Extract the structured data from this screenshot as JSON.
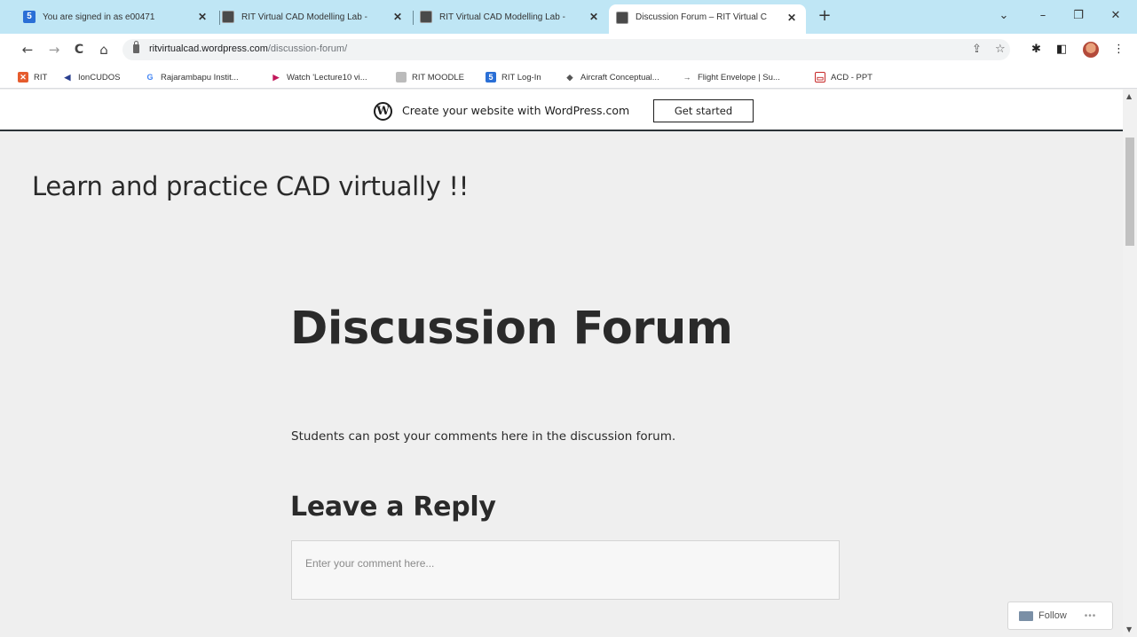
{
  "browser": {
    "tabs": [
      {
        "title": "You are signed in as e00471",
        "favicon": "s-icon"
      },
      {
        "title": "RIT Virtual CAD Modelling Lab -",
        "favicon": "site-icon"
      },
      {
        "title": "RIT Virtual CAD Modelling Lab -",
        "favicon": "site-icon"
      },
      {
        "title": "Discussion Forum – RIT Virtual C",
        "favicon": "site-icon",
        "active": true
      }
    ],
    "new_tab": "+",
    "window_controls": {
      "dropdown": "⌄",
      "minimize": "–",
      "restore": "❐",
      "close": "✕"
    },
    "nav": {
      "back": "←",
      "forward": "→",
      "reload": "C",
      "home": "⌂"
    },
    "url_domain": "ritvirtualcad.wordpress.com",
    "url_path": "/discussion-forum/",
    "toolbar_icons": {
      "share": "⇪",
      "star": "☆",
      "extensions": "✱",
      "sidepanel": "◧",
      "menu": "⋮"
    },
    "bookmarks": [
      {
        "label": "RIT",
        "color": "#e65c2e"
      },
      {
        "label": "IonCUDOS",
        "color": "#2a3f8f"
      },
      {
        "label": "Rajarambapu Instit...",
        "color": "#4285f4"
      },
      {
        "label": "Watch 'Lecture10 vi...",
        "color": "#c2185b"
      },
      {
        "label": "RIT MOODLE",
        "color": "#888888"
      },
      {
        "label": "RIT Log-In",
        "color": "#2a6fd6"
      },
      {
        "label": "Aircraft Conceptual...",
        "color": "#555555"
      },
      {
        "label": "Flight Envelope | Su...",
        "color": "#444444"
      },
      {
        "label": "ACD - PPT",
        "color": "#c62828"
      }
    ]
  },
  "wp_bar": {
    "text": "Create your website with WordPress.com",
    "button": "Get started"
  },
  "site": {
    "title": "Learn and practice CAD virtually !!"
  },
  "page": {
    "title": "Discussion Forum",
    "body": "Students can post your comments here in the discussion forum.",
    "reply_heading": "Leave a Reply",
    "comment_placeholder": "Enter your comment here..."
  },
  "follow": {
    "label": "Follow",
    "more": "•••"
  }
}
